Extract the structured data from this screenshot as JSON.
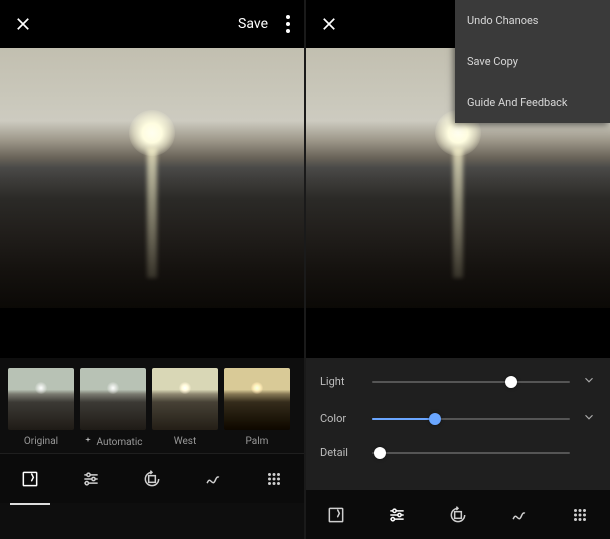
{
  "left": {
    "save_label": "Save",
    "filters": [
      {
        "label": "Original",
        "klass": "orig"
      },
      {
        "label": "Automatic",
        "klass": "auto"
      },
      {
        "label": "West",
        "klass": "west"
      },
      {
        "label": "Palm",
        "klass": "palm"
      }
    ]
  },
  "right": {
    "menu": {
      "undo": "Undo Chanoes",
      "save_copy": "Save Copy",
      "guide": "Guide And Feedback"
    },
    "adjust": {
      "light": {
        "label": "Light",
        "value": 70
      },
      "color": {
        "label": "Color",
        "value": 32
      },
      "detail": {
        "label": "Detail",
        "value": 4
      }
    }
  }
}
